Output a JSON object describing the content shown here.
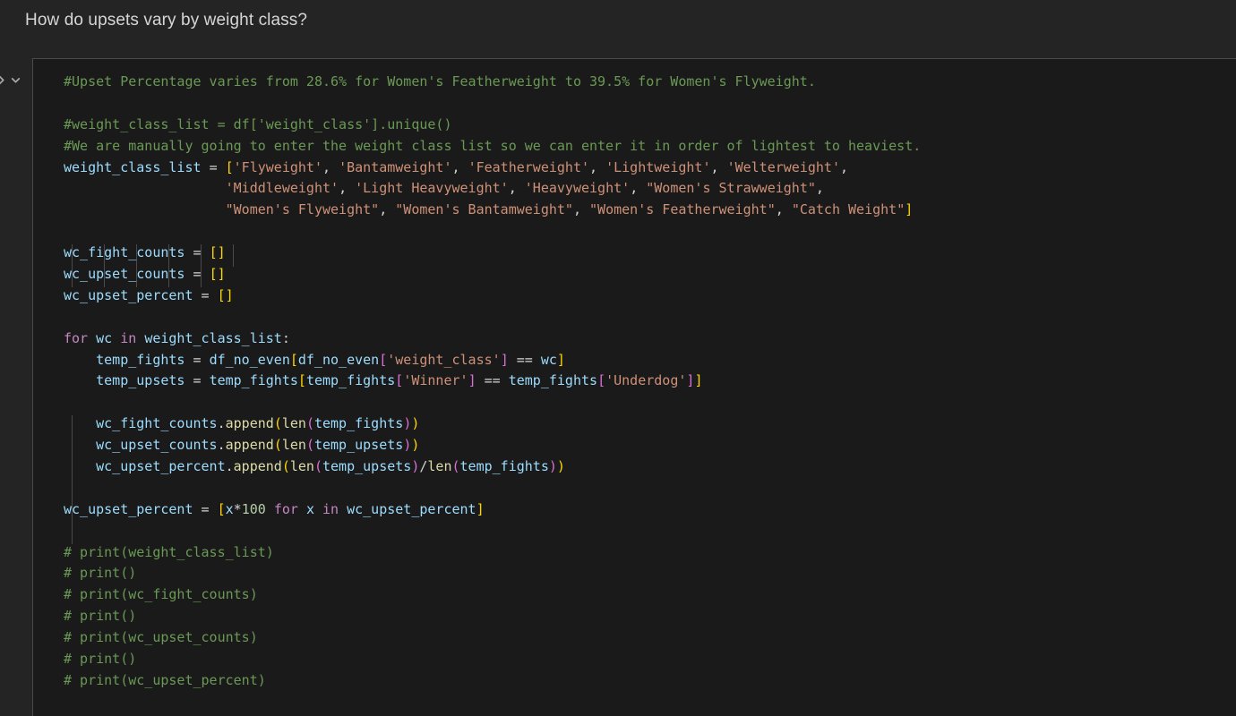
{
  "header": {
    "title": "How do upsets vary by weight class?"
  },
  "gutter": {
    "collapse_right_icon": "chevron-right-icon",
    "collapse_down_icon": "chevron-down-icon"
  },
  "colors": {
    "page_background": "#242424",
    "cell_background": "#1a1a1a",
    "cell_border": "#4a4a4a",
    "title_text": "#d6d6d6",
    "comment": "#6A9955",
    "variable": "#9CDCFE",
    "string": "#CE9178",
    "number": "#B5CEA8",
    "keyword": "#C586C0",
    "function": "#DCDCAA",
    "operator": "#D4D4D4",
    "bracket_level_1": "#FFD700",
    "bracket_level_2": "#DA70D6",
    "bracket_level_3": "#179FFF"
  },
  "code_cell": {
    "language": "python",
    "lines": [
      "#Upset Percentage varies from 28.6% for Women's Featherweight to 39.5% for Women's Flyweight.",
      "",
      "#weight_class_list = df['weight_class'].unique()",
      "#We are manually going to enter the weight class list so we can enter it in order of lightest to heaviest.",
      "weight_class_list = ['Flyweight', 'Bantamweight', 'Featherweight', 'Lightweight', 'Welterweight',",
      "                    'Middleweight', 'Light Heavyweight', 'Heavyweight', \"Women's Strawweight\",",
      "                    \"Women's Flyweight\", \"Women's Bantamweight\", \"Women's Featherweight\", \"Catch Weight\"]",
      "",
      "wc_fight_counts = []",
      "wc_upset_counts = []",
      "wc_upset_percent = []",
      "",
      "for wc in weight_class_list:",
      "    temp_fights = df_no_even[df_no_even['weight_class'] == wc]",
      "    temp_upsets = temp_fights[temp_fights['Winner'] == temp_fights['Underdog']]",
      "",
      "    wc_fight_counts.append(len(temp_fights))",
      "    wc_upset_counts.append(len(temp_upsets))",
      "    wc_upset_percent.append(len(temp_upsets)/len(temp_fights))",
      "",
      "wc_upset_percent = [x*100 for x in wc_upset_percent]",
      "",
      "# print(weight_class_list)",
      "# print()",
      "# print(wc_fight_counts)",
      "# print()",
      "# print(wc_upset_counts)",
      "# print()",
      "# print(wc_upset_percent)"
    ],
    "facts": {
      "min_upset_percentage": "28.6%",
      "min_upset_weight_class": "Women's Featherweight",
      "max_upset_percentage": "39.5%",
      "max_upset_weight_class": "Women's Flyweight"
    },
    "weight_class_list": [
      "Flyweight",
      "Bantamweight",
      "Featherweight",
      "Lightweight",
      "Welterweight",
      "Middleweight",
      "Light Heavyweight",
      "Heavyweight",
      "Women's Strawweight",
      "Women's Flyweight",
      "Women's Bantamweight",
      "Women's Featherweight",
      "Catch Weight"
    ]
  }
}
